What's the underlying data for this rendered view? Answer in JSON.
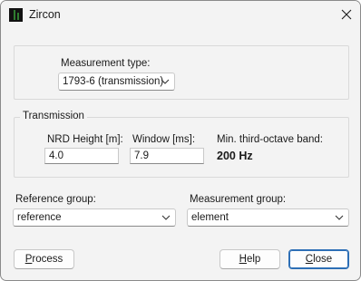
{
  "window": {
    "title": "Zircon",
    "icon": "zircon-app-icon",
    "close_icon": "close-icon"
  },
  "measurement_type": {
    "label": "Measurement type:",
    "selected": "1793-6 (transmission)"
  },
  "transmission": {
    "group_label": "Transmission",
    "nrd_height_label": "NRD Height [m]:",
    "nrd_height_value": "4.0",
    "window_label": "Window [ms]:",
    "window_value": "7.9",
    "min_band_label": "Min. third-octave band:",
    "min_band_value": "200 Hz"
  },
  "reference_group": {
    "label": "Reference group:",
    "selected": "reference"
  },
  "measurement_group": {
    "label": "Measurement group:",
    "selected": "element"
  },
  "buttons": {
    "process_first": "P",
    "process_rest": "rocess",
    "help_first": "H",
    "help_rest": "elp",
    "close_first": "C",
    "close_rest": "lose"
  },
  "colors": {
    "window_bg": "#f3f3f3",
    "default_button_border": "#2d6fb6",
    "icon_green": "#2f7d2f"
  }
}
